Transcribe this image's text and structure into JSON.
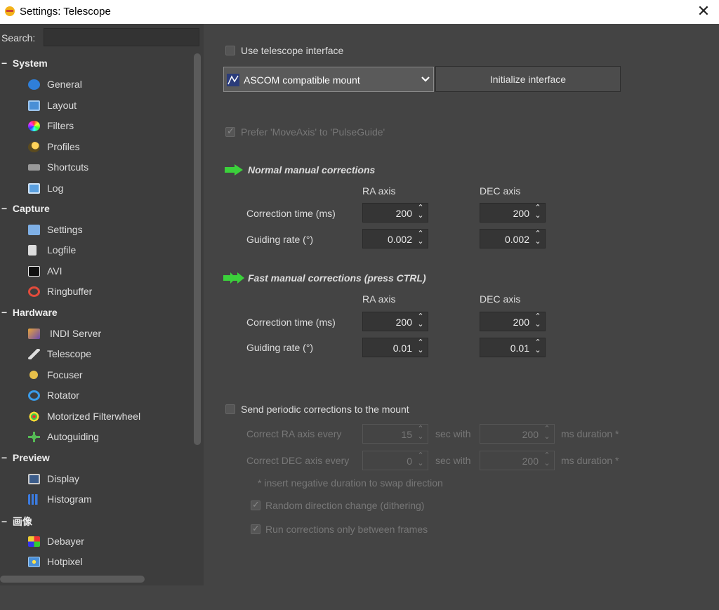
{
  "window": {
    "title": "Settings: Telescope",
    "close_glyph": "✕"
  },
  "sidebar": {
    "search_label": "Search:",
    "search_value": "",
    "categories": [
      {
        "label": "System",
        "toggle": "−",
        "items": [
          "General",
          "Layout",
          "Filters",
          "Profiles",
          "Shortcuts",
          "Log"
        ]
      },
      {
        "label": "Capture",
        "toggle": "−",
        "items": [
          "Settings",
          "Logfile",
          "AVI",
          "Ringbuffer"
        ]
      },
      {
        "label": "Hardware",
        "toggle": "−",
        "items": [
          "INDI Server",
          "Telescope",
          "Focuser",
          "Rotator",
          "Motorized Filterwheel",
          "Autoguiding"
        ]
      },
      {
        "label": "Preview",
        "toggle": "−",
        "items": [
          "Display",
          "Histogram"
        ]
      },
      {
        "label": "画像",
        "toggle": "−",
        "items": [
          "Debayer",
          "Hotpixel"
        ]
      }
    ]
  },
  "main": {
    "use_interface_label": "Use telescope interface",
    "mount_combo_value": "ASCOM compatible mount",
    "init_button": "Initialize interface",
    "prefer_moveaxis_label": "Prefer 'MoveAxis' to 'PulseGuide'",
    "normal": {
      "title": "Normal manual corrections",
      "ra_header": "RA axis",
      "dec_header": "DEC axis",
      "correction_time_label": "Correction time (ms)",
      "guiding_rate_label": "Guiding rate (°)",
      "ra_time": "200",
      "dec_time": "200",
      "ra_rate": "0.002",
      "dec_rate": "0.002"
    },
    "fast": {
      "title": "Fast manual corrections (press CTRL)",
      "ra_header": "RA axis",
      "dec_header": "DEC axis",
      "correction_time_label": "Correction time (ms)",
      "guiding_rate_label": "Guiding rate (°)",
      "ra_time": "200",
      "dec_time": "200",
      "ra_rate": "0.01",
      "dec_rate": "0.01"
    },
    "periodic": {
      "label": "Send periodic corrections to the mount",
      "ra_label": "Correct RA axis every",
      "ra_value": "15",
      "ra_duration": "200",
      "dec_label": "Correct DEC axis every",
      "dec_value": "0",
      "dec_duration": "200",
      "sec_with": "sec with",
      "ms_duration": "ms duration *",
      "note": "* insert negative duration to swap direction",
      "random_label": "Random direction change (dithering)",
      "between_frames_label": "Run corrections only between frames"
    },
    "spin_glyph": "⌃⌄"
  }
}
